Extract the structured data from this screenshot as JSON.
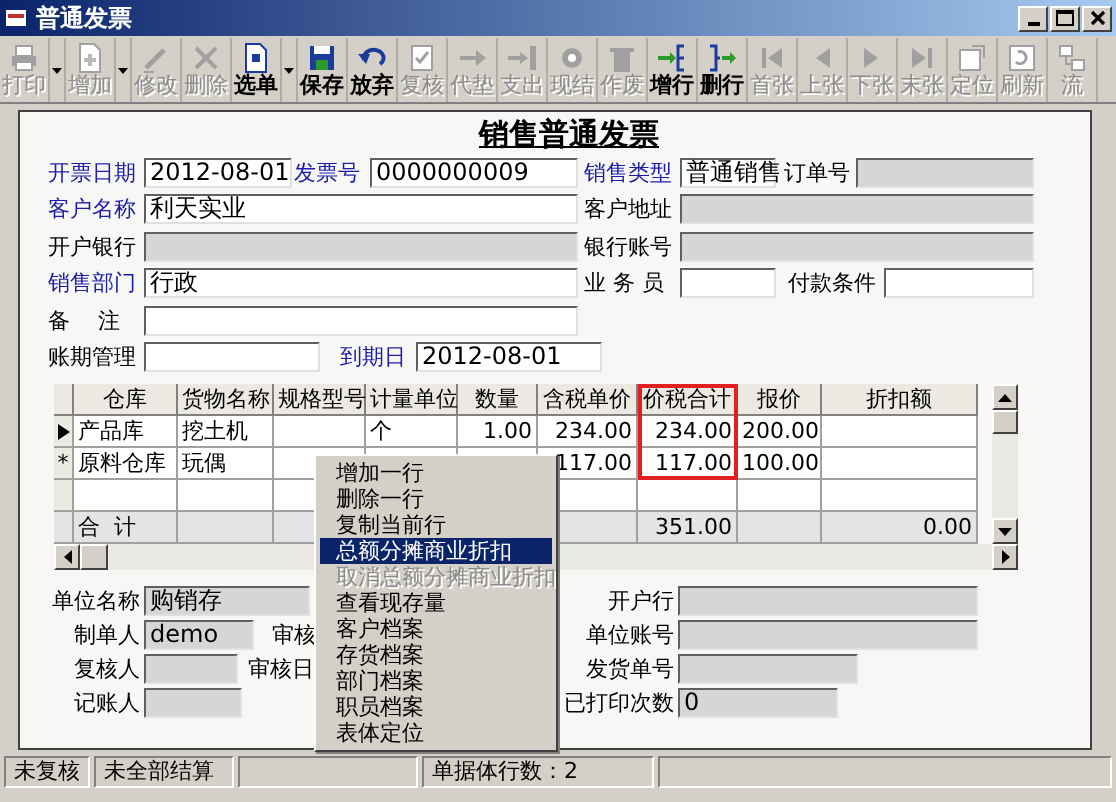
{
  "window": {
    "title": "普通发票"
  },
  "toolbar": [
    {
      "label": "打印",
      "disabled": true,
      "dropdown": true
    },
    {
      "label": "增加",
      "disabled": true,
      "dropdown": true
    },
    {
      "label": "修改",
      "disabled": true,
      "dropdown": false
    },
    {
      "label": "删除",
      "disabled": true,
      "dropdown": false
    },
    {
      "label": "选单",
      "disabled": false,
      "dropdown": true
    },
    {
      "label": "保存",
      "disabled": false,
      "dropdown": false
    },
    {
      "label": "放弃",
      "disabled": false,
      "dropdown": false
    },
    {
      "label": "复核",
      "disabled": true,
      "dropdown": false
    },
    {
      "label": "代垫",
      "disabled": true,
      "dropdown": false
    },
    {
      "label": "支出",
      "disabled": true,
      "dropdown": false
    },
    {
      "label": "现结",
      "disabled": true,
      "dropdown": false
    },
    {
      "label": "作废",
      "disabled": true,
      "dropdown": false
    },
    {
      "label": "增行",
      "disabled": false,
      "dropdown": false
    },
    {
      "label": "删行",
      "disabled": false,
      "dropdown": false
    },
    {
      "label": "首张",
      "disabled": true,
      "dropdown": false
    },
    {
      "label": "上张",
      "disabled": true,
      "dropdown": false
    },
    {
      "label": "下张",
      "disabled": true,
      "dropdown": false
    },
    {
      "label": "末张",
      "disabled": true,
      "dropdown": false
    },
    {
      "label": "定位",
      "disabled": true,
      "dropdown": false
    },
    {
      "label": "刷新",
      "disabled": true,
      "dropdown": false
    },
    {
      "label": "流",
      "disabled": true,
      "dropdown": false
    }
  ],
  "form_title": "销售普通发票",
  "header_rows": [
    [
      {
        "label": "开票日期",
        "value": "2012-08-01",
        "required": true,
        "disabled": false
      },
      {
        "label": "发票号",
        "value": "0000000009",
        "required": true,
        "disabled": false
      },
      {
        "label": "销售类型",
        "value": "普通销售",
        "required": true,
        "disabled": false
      },
      {
        "label": "订单号",
        "required": false,
        "disabled": true
      }
    ],
    [
      {
        "label": "客户名称",
        "value": "利天实业",
        "required": true,
        "disabled": false
      },
      {
        "label": "客户地址",
        "required": false,
        "disabled": true
      }
    ],
    [
      {
        "label": "开户银行",
        "required": false,
        "disabled": true
      },
      {
        "label": "银行账号",
        "required": false,
        "disabled": true
      }
    ],
    [
      {
        "label": "销售部门",
        "value": "行政",
        "required": true,
        "disabled": false
      },
      {
        "label": "业 务 员",
        "required": false,
        "disabled": false
      },
      {
        "label": "付款条件",
        "required": false,
        "disabled": false
      }
    ],
    [
      {
        "label": "备    注",
        "required": false,
        "disabled": false
      }
    ],
    [
      {
        "label": "账期管理",
        "required": false,
        "disabled": false
      },
      {
        "label": "到期日",
        "value": "2012-08-01",
        "required": true,
        "disabled": false
      }
    ]
  ],
  "table": {
    "columns": [
      {
        "label": "仓库",
        "highlighted": false
      },
      {
        "label": "货物名称",
        "highlighted": false
      },
      {
        "label": "规格型号",
        "highlighted": false
      },
      {
        "label": "计量单位",
        "highlighted": false
      },
      {
        "label": "数量",
        "highlighted": false
      },
      {
        "label": "含税单价",
        "highlighted": false
      },
      {
        "label": "价税合计",
        "highlighted": true
      },
      {
        "label": "报价",
        "highlighted": false
      },
      {
        "label": "折扣额",
        "highlighted": false
      }
    ],
    "rows": [
      {
        "selected": true,
        "cells": [
          "产品库",
          "挖土机",
          null,
          "个",
          "1.00",
          "234.00",
          "234.00",
          "200.00",
          null
        ]
      },
      {
        "selected": false,
        "marker": "*",
        "cells": [
          "原料仓库",
          "玩偶",
          null,
          null,
          null,
          "117.00",
          "117.00",
          "100.00",
          null
        ]
      }
    ],
    "total": {
      "label": "合  计",
      "cells": [
        null,
        null,
        null,
        null,
        null,
        null,
        "351.00",
        null,
        "0.00"
      ]
    }
  },
  "context_menu": [
    {
      "label": "增加一行",
      "selected": false,
      "disabled": false
    },
    {
      "label": "删除一行",
      "selected": false,
      "disabled": false
    },
    {
      "label": "复制当前行",
      "selected": false,
      "disabled": false
    },
    {
      "label": "总额分摊商业折扣",
      "selected": true,
      "disabled": false
    },
    {
      "label": "取消总额分摊商业折扣",
      "selected": false,
      "disabled": true
    },
    {
      "label": "查看现存量",
      "selected": false,
      "disabled": false
    },
    {
      "label": "客户档案",
      "selected": false,
      "disabled": false
    },
    {
      "label": "存货档案",
      "selected": false,
      "disabled": false
    },
    {
      "label": "部门档案",
      "selected": false,
      "disabled": false
    },
    {
      "label": "职员档案",
      "selected": false,
      "disabled": false
    },
    {
      "label": "表体定位",
      "selected": false,
      "disabled": false
    }
  ],
  "footer_rows": [
    {
      "left": [
        {
          "kind": "field",
          "label": "单位名称",
          "value": "购销存",
          "disabled": true
        }
      ],
      "right": {
        "label": "开户行",
        "disabled": true
      }
    },
    {
      "left": [
        {
          "kind": "field",
          "label": "制单人",
          "value": "demo",
          "disabled": true
        },
        {
          "kind": "label",
          "label": "审核"
        }
      ],
      "right": {
        "label": "单位账号",
        "disabled": true
      }
    },
    {
      "left": [
        {
          "kind": "field",
          "label": "复核人",
          "disabled": true
        },
        {
          "kind": "label",
          "label": "审核日"
        }
      ],
      "right": {
        "label": "发货单号",
        "disabled": true
      }
    },
    {
      "left": [
        {
          "kind": "field",
          "label": "记账人",
          "disabled": true
        }
      ],
      "right": {
        "label": "已打印次数",
        "value": "0",
        "disabled": true
      }
    }
  ],
  "status_bar": [
    "未复核",
    "未全部结算",
    "单据体行数：2"
  ]
}
